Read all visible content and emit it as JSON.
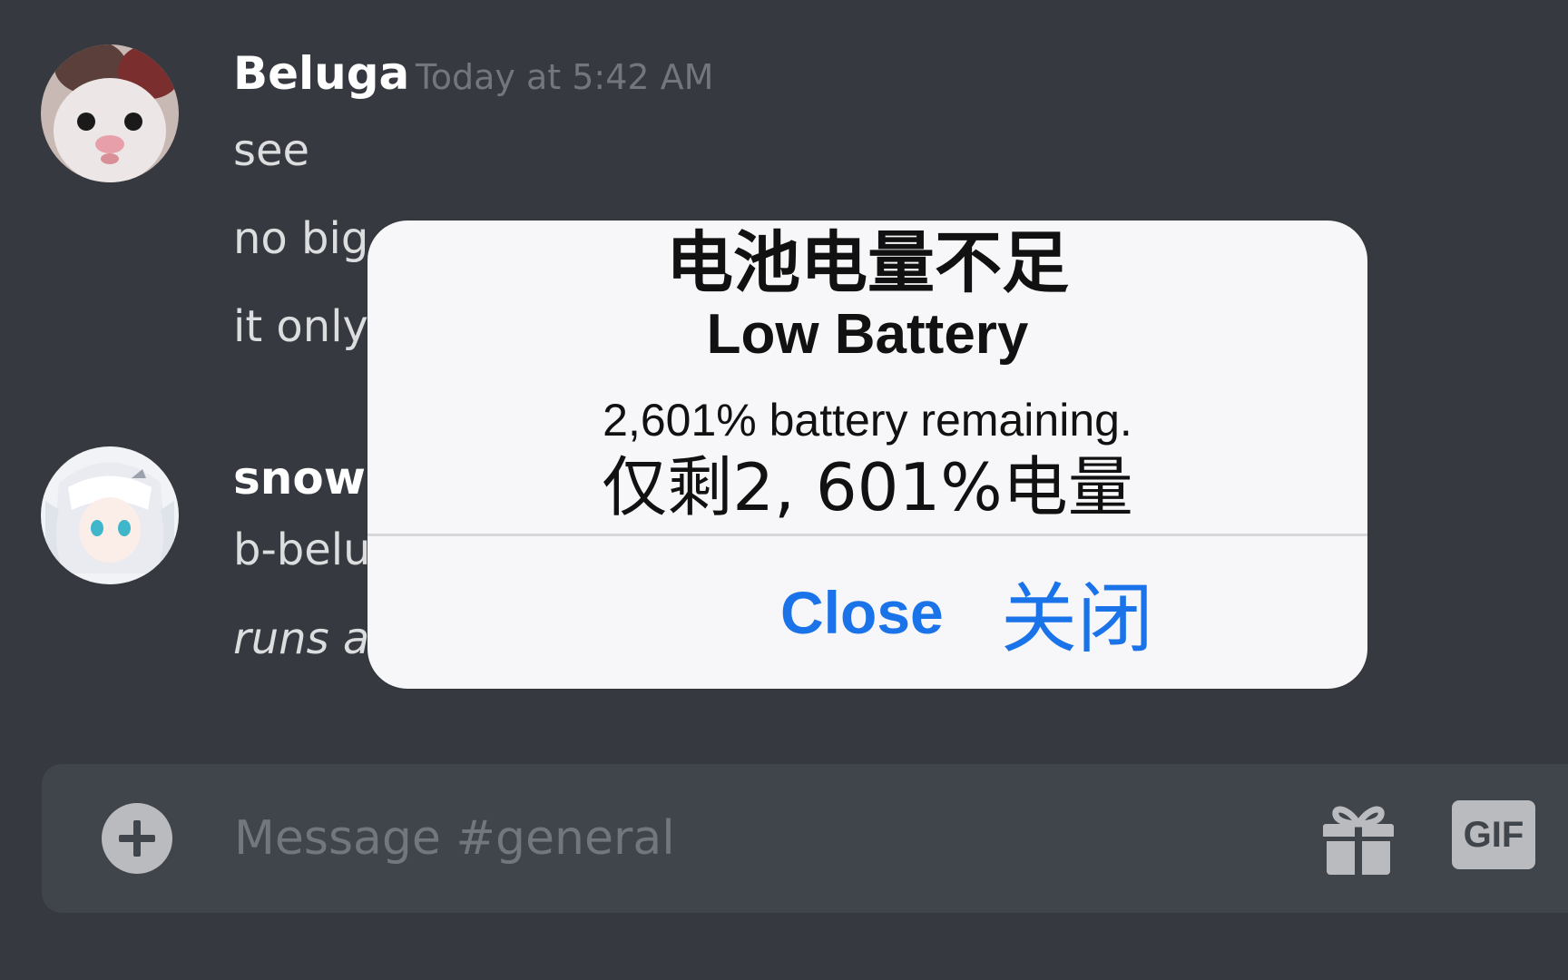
{
  "channel": {
    "composer_placeholder": "Message #general",
    "gif_label": "GIF"
  },
  "messages": [
    {
      "author": "Beluga",
      "timestamp": "Today at 5:42 AM",
      "lines": [
        "see",
        "no big",
        "it only"
      ]
    },
    {
      "author": "snowi",
      "lines": [
        "b-belu",
        "runs a"
      ]
    }
  ],
  "alert": {
    "title_cn": "电池电量不足",
    "title_en": "Low Battery",
    "message_en": "2,601% battery remaining.",
    "message_cn": "仅剩2, 601%电量",
    "close_en": "Close",
    "close_cn": "关闭"
  },
  "icons": {
    "add": "plus-circle-icon",
    "gift": "gift-icon",
    "gif": "gif-icon"
  },
  "colors": {
    "background": "#36393f",
    "composer": "#40444b",
    "accent_blue": "#1a73e8",
    "timestamp": "#72767d",
    "message_text": "#dcddde"
  }
}
